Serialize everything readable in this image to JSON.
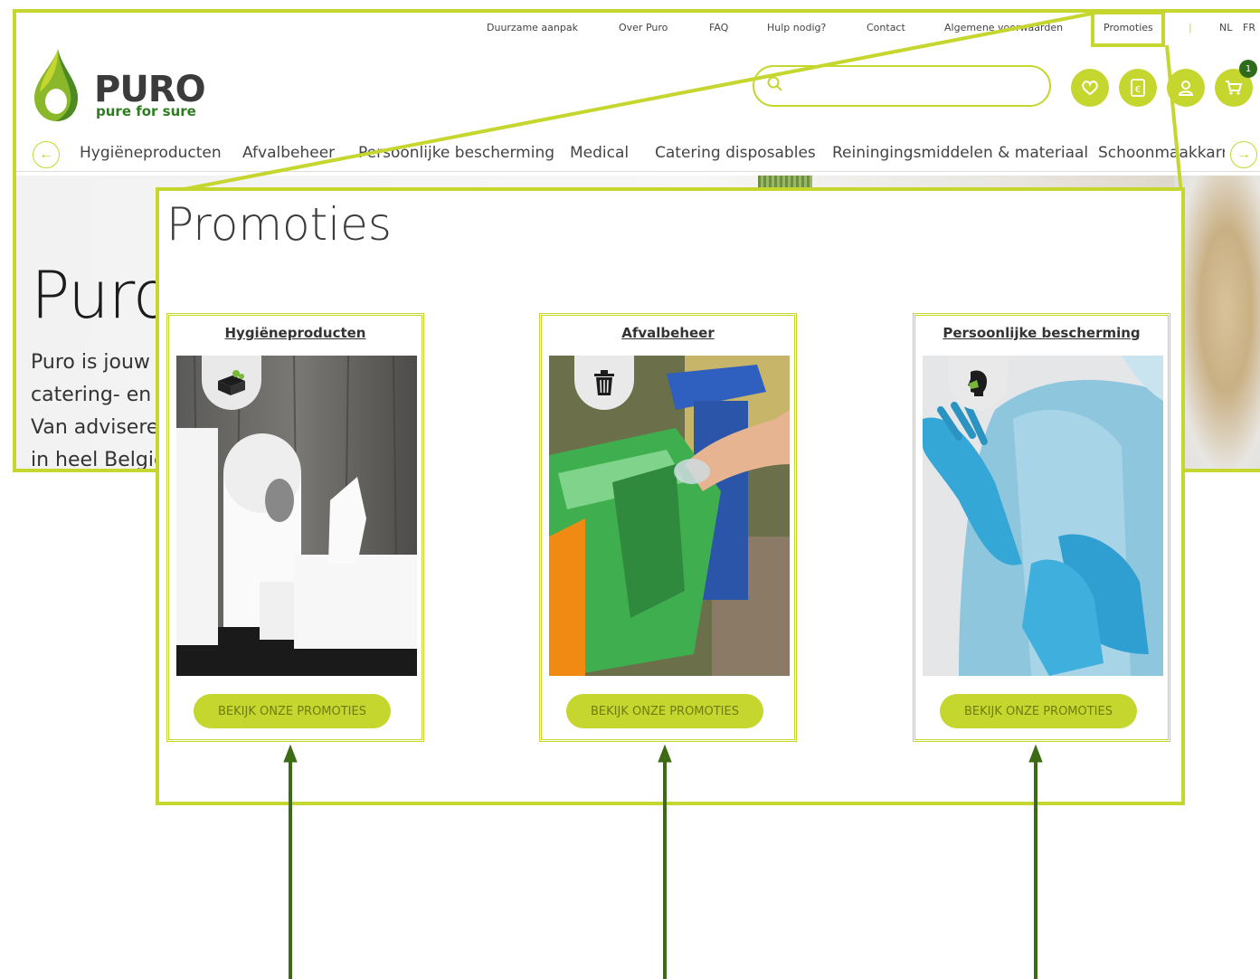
{
  "top_nav": {
    "items": [
      "Duurzame aanpak",
      "Over Puro",
      "FAQ",
      "Hulp nodig?",
      "Contact",
      "Algemene voorwaarden",
      "Promoties"
    ],
    "separator": "|",
    "languages": [
      "NL",
      "FR"
    ]
  },
  "logo": {
    "name": "PURO",
    "tagline": "pure for sure"
  },
  "header": {
    "cart_count": "1"
  },
  "category_nav": {
    "items": [
      "Hygiëneproducten",
      "Afvalbeheer",
      "Persoonlijke bescherming",
      "Medical",
      "Catering disposables",
      "Reiningingsmiddelen & materiaal",
      "Schoonmaakkarren"
    ]
  },
  "hero": {
    "title": "Puro",
    "lines": [
      "Puro is jouw p",
      "catering- en s",
      "Van adviseren",
      "in heel België"
    ]
  },
  "promo_panel": {
    "title": "Promoties",
    "cards": [
      {
        "title": "Hygiëneproducten",
        "button": "BEKIJK ONZE PROMOTIES",
        "icon": "tissue-box-icon"
      },
      {
        "title": "Afvalbeheer",
        "button": "BEKIJK ONZE PROMOTIES",
        "icon": "trash-bin-icon"
      },
      {
        "title": "Persoonlijke bescherming",
        "button": "BEKIJK ONZE PROMOTIES",
        "icon": "face-mask-icon"
      }
    ]
  },
  "colors": {
    "accent": "#c5d62f",
    "dark_green": "#3d6b15",
    "brand_green": "#2e7d20"
  }
}
